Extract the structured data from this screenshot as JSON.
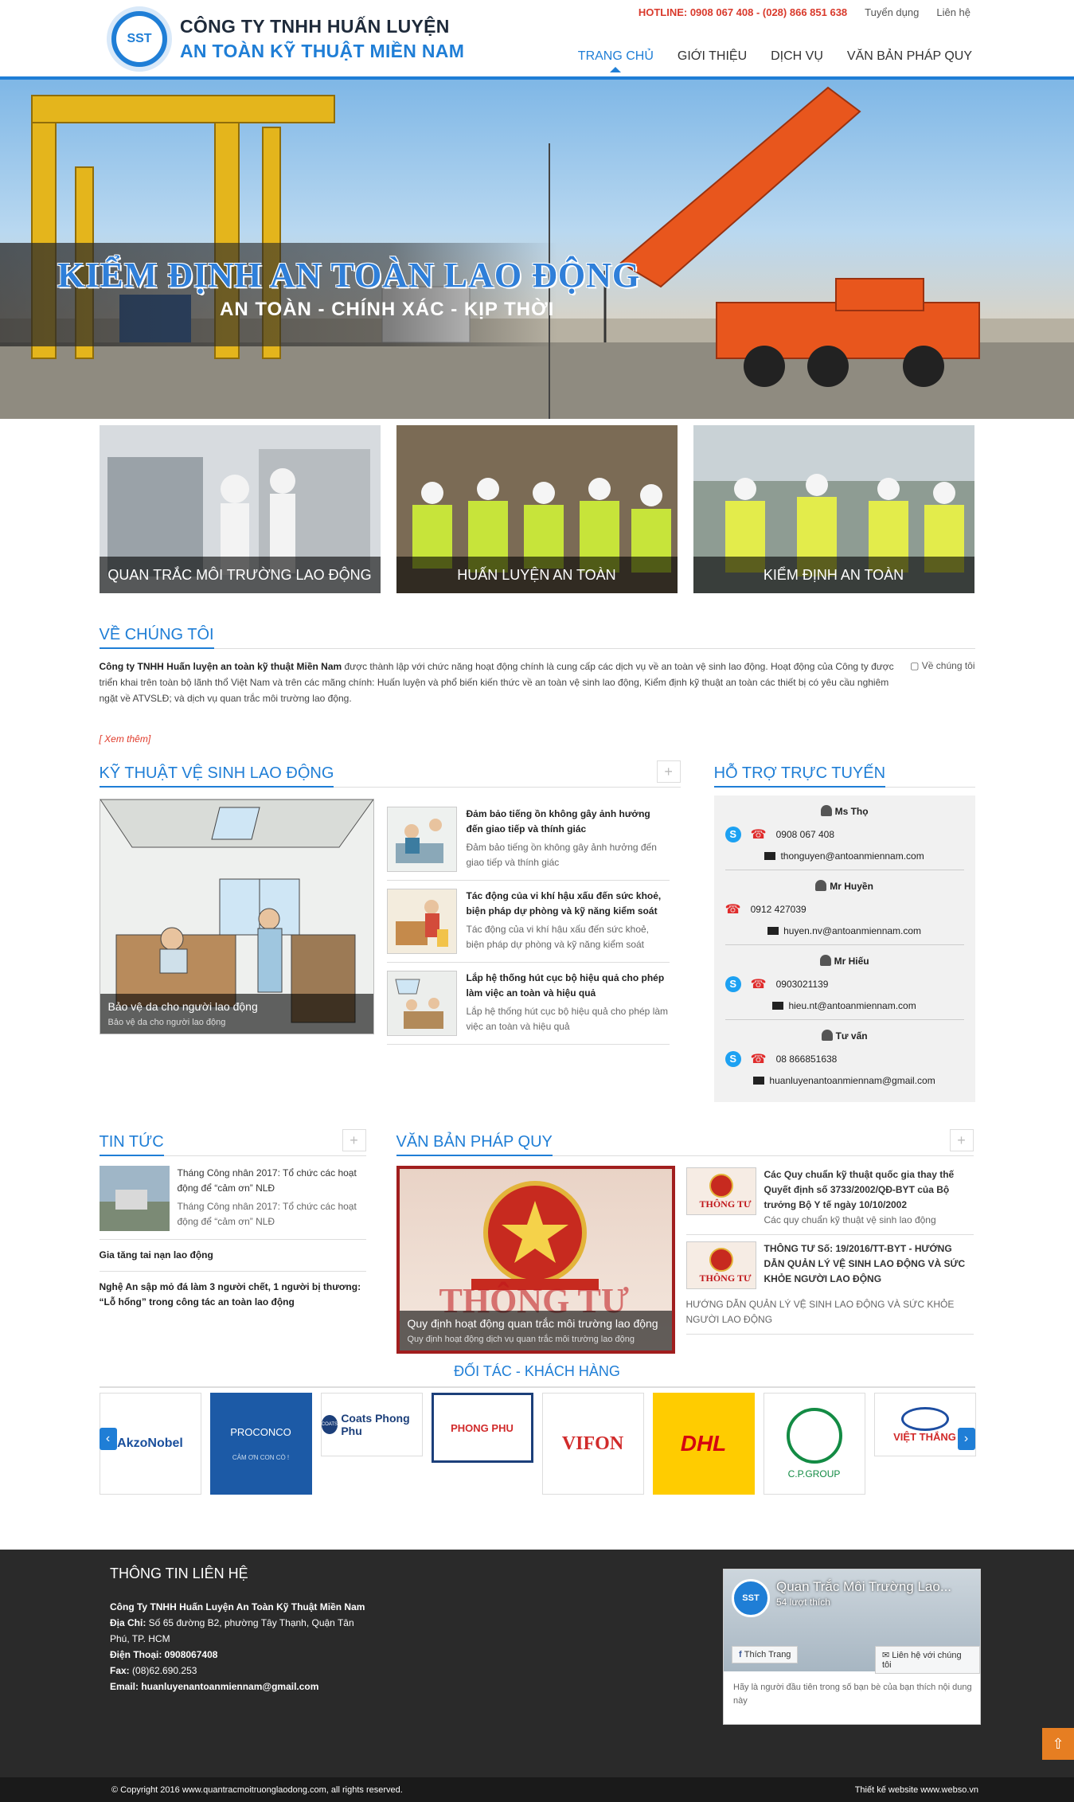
{
  "header": {
    "logo_mark": "SST",
    "logo_line1": "CÔNG TY TNHH HUẤN LUYỆN",
    "logo_line2": "AN TOÀN KỸ THUẬT MIỀN NAM",
    "hotline": "HOTLINE: 0908 067 408 - (028) 866 851 638",
    "top_links": [
      "Tuyển dụng",
      "Liên hệ"
    ],
    "nav": [
      "TRANG CHỦ",
      "GIỚI THIỆU",
      "DỊCH VỤ",
      "VĂN BẢN PHÁP QUY"
    ],
    "active_nav": "TRANG CHỦ"
  },
  "banner": {
    "title": "KIỂM ĐỊNH AN TOÀN LAO ĐỘNG",
    "subtitle": "AN TOÀN - CHÍNH XÁC - KỊP THỜI"
  },
  "services": [
    "QUAN TRẮC MÔI TRƯỜNG LAO ĐỘNG",
    "HUẤN LUYỆN AN TOÀN",
    "KIỂM ĐỊNH AN TOÀN"
  ],
  "about": {
    "title": "VỀ CHÚNG TÔI",
    "company": "Công ty TNHH Huấn luyện an toàn kỹ thuật Miền Nam",
    "text": " được thành lập với chức năng hoạt động chính là cung cấp các dịch vụ về an toàn vệ sinh lao động. Hoạt động của Công ty được triển khai trên toàn bộ lãnh thổ Việt Nam và trên các mãng chính: Huấn luyện và phổ biến kiến thức về an toàn vệ sinh lao động, Kiểm định kỹ thuật an toàn các thiết bị có yêu cầu nghiêm ngặt về ATVSLĐ; và dịch vụ quan trắc môi trường lao động.",
    "image_alt": "Về chúng tôi",
    "more": "[ Xem thêm]"
  },
  "ktvs": {
    "title": "KỸ THUẬT VỆ SINH LAO ĐỘNG",
    "plus": "+",
    "feature_title": "Bảo vệ da cho người lao động",
    "feature_desc": "Bảo vệ da cho người lao động",
    "articles": [
      {
        "title": "Đảm bảo tiếng ồn không gây ảnh hưởng đến giao tiếp và thính giác",
        "desc": "Đảm bảo tiếng ồn không gây ảnh hưởng đến giao tiếp và thính giác"
      },
      {
        "title": "Tác động của vi khí hậu xấu đến sức khoẻ, biện pháp dự phòng và kỹ năng kiểm soát",
        "desc": "Tác động của vi khí hậu xấu đến sức khoẻ, biện pháp dự phòng và kỹ năng kiểm soát"
      },
      {
        "title": "Lắp hệ thống hút cục bộ hiệu quả cho phép làm việc an toàn và hiệu quả",
        "desc": "Lắp hệ thống hút cục bộ hiệu quả cho phép làm việc an toàn và hiệu quả"
      }
    ]
  },
  "support": {
    "title": "HỖ TRỢ TRỰC TUYẾN",
    "items": [
      {
        "name": "Ms Thọ",
        "phone": "0908 067 408",
        "email": "thonguyen@antoanmiennam.com"
      },
      {
        "name": "Mr Huyền",
        "phone": "0912 427039",
        "email": "huyen.nv@antoanmiennam.com"
      },
      {
        "name": "Mr Hiếu",
        "phone": "0903021139",
        "email": "hieu.nt@antoanmiennam.com"
      },
      {
        "name": "Tư vấn",
        "phone": "08 866851638",
        "email": "huanluyenantoanmiennam@gmail.com"
      }
    ]
  },
  "news": {
    "title": "TIN TỨC",
    "plus": "+",
    "first_title": "Tháng Công nhân 2017: Tổ chức các hoạt động để “cảm ơn” NLĐ",
    "first_desc": "Tháng Công nhân 2017: Tổ chức các hoạt động để “cảm ơn” NLĐ",
    "items": [
      "Gia tăng tai nạn lao động",
      "Nghệ An sập mỏ đá làm 3 người chết, 1 người bị thương: “Lỗ hổng” trong công tác an toàn lao động"
    ]
  },
  "law": {
    "title": "VĂN BẢN PHÁP QUY",
    "plus": "+",
    "thumb_label": "THÔNG TƯ",
    "feature_title": "Quy định hoạt động quan trắc môi trường lao động",
    "feature_desc": "Quy định hoạt động dịch vụ quan trắc môi trường lao động",
    "articles": [
      {
        "title": "Các Quy chuẩn kỹ thuật quốc gia thay thế Quyết định số 3733/2002/QĐ-BYT của Bộ trưởng Bộ Y tế ngày 10/10/2002",
        "desc": "Các quy chuẩn kỹ thuật vệ sinh lao động"
      },
      {
        "title": "THÔNG TƯ Số: 19/2016/TT-BYT - HƯỚNG DẪN QUẢN LÝ VỆ SINH LAO ĐỘNG VÀ SỨC KHỎE NGƯỜI LAO ĐỘNG",
        "desc": "HƯỚNG DẪN QUẢN LÝ VỆ SINH LAO ĐỘNG VÀ SỨC KHỎE NGƯỜI LAO ĐỘNG"
      }
    ]
  },
  "partners": {
    "title": "ĐỐI TÁC - KHÁCH HÀNG",
    "logos": [
      "AkzoNobel",
      "PROCONCO",
      "Coats Phong Phu",
      "PHONG PHU",
      "VIFON",
      "DHL",
      "C.P.GROUP",
      "VIỆT THẮNG"
    ],
    "proconco_tag": "CẢM ƠN CON CÒ !",
    "coats_badge": "COATS",
    "arrow_left": "‹",
    "arrow_right": "›"
  },
  "footer": {
    "title": "THÔNG TIN LIÊN HỆ",
    "company": "Công Ty TNHH Huấn Luyện An Toàn Kỹ Thuật Miền Nam",
    "address_label": "Địa Chỉ:",
    "address": " Số 65 đường B2, phường Tây Thạnh, Quận Tân Phú, TP. HCM",
    "phone_label": "Điện Thoại:",
    "phone": " 0908067408",
    "fax_label": "Fax:",
    "fax": " (08)62.690.253",
    "email_label": "Email:",
    "email": " huanluyenantoanmiennam@gmail.com",
    "fb_page": "Quan Trắc Môi Trường Lao...",
    "fb_likes": "54 lượt thích",
    "fb_like_btn": "Thích Trang",
    "fb_contact_btn": "Liên hệ với chúng tôi",
    "fb_text": "Hãy là người đầu tiên trong số bạn bè của bạn thích nội dung này",
    "copyright": "© Copyright 2016 www.quantracmoitruonglaodong.com, all rights reserved.",
    "designer": "Thiết kế website www.webso.vn",
    "to_top": "⇧"
  }
}
